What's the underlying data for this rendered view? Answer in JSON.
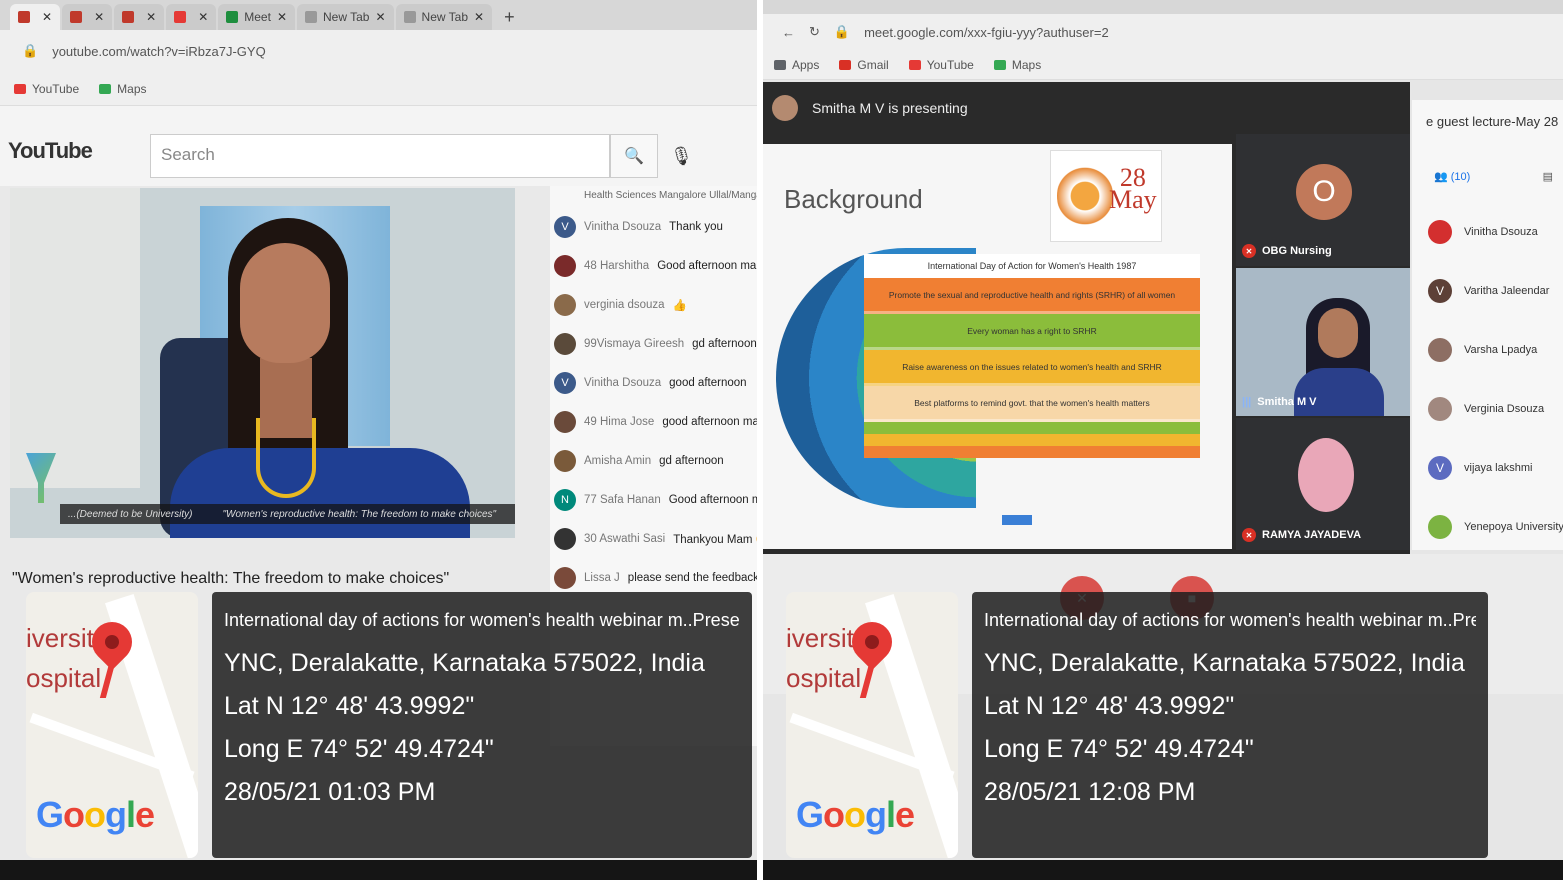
{
  "left": {
    "tabs": [
      {
        "label": "",
        "color": "#c0392b"
      },
      {
        "label": "",
        "color": "#c0392b"
      },
      {
        "label": "",
        "color": "#c0392b"
      },
      {
        "label": "",
        "color": "#e53935"
      },
      {
        "label": "Meet",
        "color": "#1e8e3e"
      },
      {
        "label": "New Tab",
        "color": "#999999"
      },
      {
        "label": "New Tab",
        "color": "#999999"
      }
    ],
    "url": "youtube.com/watch?v=iRbza7J-GYQ",
    "bookmarks": [
      "YouTube",
      "Maps"
    ],
    "youtube": {
      "logo": "YouTube",
      "search_placeholder": "Search",
      "video_caption_left": "...(Deemed to be University)",
      "video_caption_right": "\"Women's reproductive health: The freedom to make choices\"",
      "video_title": "\"Women's reproductive health: The freedom to make choices\""
    },
    "chat": {
      "header_partial": "Health Sciences Mangalore Ullal/Mangalore",
      "messages": [
        {
          "initial": "V",
          "color": "#3c5a8a",
          "name": "Vinitha Dsouza",
          "text": "Thank you"
        },
        {
          "initial": "",
          "color": "#7a2a2a",
          "name": "48 Harshitha",
          "text": "Good afternoon mam"
        },
        {
          "initial": "",
          "color": "#8a6a4a",
          "name": "verginia dsouza",
          "text": "👍"
        },
        {
          "initial": "",
          "color": "#5a4a3a",
          "name": "99Vismaya Gireesh",
          "text": "gd afternoon mam"
        },
        {
          "initial": "V",
          "color": "#3c5a8a",
          "name": "Vinitha Dsouza",
          "text": "good afternoon"
        },
        {
          "initial": "",
          "color": "#6a4a3a",
          "name": "49 Hima Jose",
          "text": "good afternoon maam"
        },
        {
          "initial": "",
          "color": "#7a5a3a",
          "name": "Amisha Amin",
          "text": "gd afternoon"
        },
        {
          "initial": "N",
          "color": "#00897b",
          "name": "77 Safa Hanan",
          "text": "Good afternoon mam"
        },
        {
          "initial": "",
          "color": "#333333",
          "name": "30 Aswathi Sasi",
          "text": "Thankyou Mam 😊"
        },
        {
          "initial": "",
          "color": "#7a4a3a",
          "name": "Lissa J",
          "text": "please send the feedback"
        }
      ]
    },
    "geo": {
      "map_text_line1": "iversity",
      "map_text_line2": "ospital",
      "title": "International day of actions for women's health webinar m..Presentation, India",
      "address": "YNC, Deralakatte, Karnataka 575022, India",
      "lat": "Lat N 12° 48' 43.9992\"",
      "long": "Long E 74° 52' 49.4724\"",
      "datetime": "28/05/21 01:03 PM"
    }
  },
  "right": {
    "url": "meet.google.com/xxx-fgiu-yyy?authuser=2",
    "bookmarks": [
      "Apps",
      "Gmail",
      "YouTube",
      "Maps"
    ],
    "presenting": "Smitha M V is presenting",
    "slide": {
      "title": "Background",
      "badge_day": "28",
      "badge_month": "May",
      "table_header": "International Day of Action for Women's Health 1987",
      "rows": [
        {
          "text": "Promote the sexual and reproductive health and rights (SRHR) of all women",
          "color": "#f07f33"
        },
        {
          "text": "Every woman has a right to SRHR",
          "color": "#8bbd3b"
        },
        {
          "text": "Raise awareness on the issues related to women's health and SRHR",
          "color": "#f1b62f"
        },
        {
          "text": "Best platforms to remind govt. that the women's health matters",
          "color": "#f7d7a8"
        }
      ]
    },
    "tiles": [
      {
        "initial": "O",
        "label": "OBG Nursing"
      },
      {
        "label": "Smitha M V"
      },
      {
        "label": "RAMYA JAYADEVA"
      }
    ],
    "people": {
      "title": "e guest lecture-May 28",
      "count_label": "(10)",
      "list": [
        {
          "initial": "",
          "color": "#d32f2f",
          "name": "Vinitha Dsouza"
        },
        {
          "initial": "V",
          "color": "#5d4037",
          "name": "Varitha Jaleendar"
        },
        {
          "initial": "",
          "color": "#8d6e63",
          "name": "Varsha Lpadya"
        },
        {
          "initial": "",
          "color": "#a1887f",
          "name": "Verginia Dsouza"
        },
        {
          "initial": "V",
          "color": "#5c6bc0",
          "name": "vijaya lakshmi"
        },
        {
          "initial": "",
          "color": "#7cb342",
          "name": "Yenepoya University"
        }
      ]
    },
    "geo": {
      "map_text_line1": "iversity",
      "map_text_line2": "ospital",
      "title": "International day of actions for women's health webinar m..Presentation, India",
      "address": "YNC, Deralakatte, Karnataka 575022, India",
      "lat": "Lat N 12° 48' 43.9992\"",
      "long": "Long E 74° 52' 49.4724\"",
      "datetime": "28/05/21 12:08 PM"
    }
  }
}
